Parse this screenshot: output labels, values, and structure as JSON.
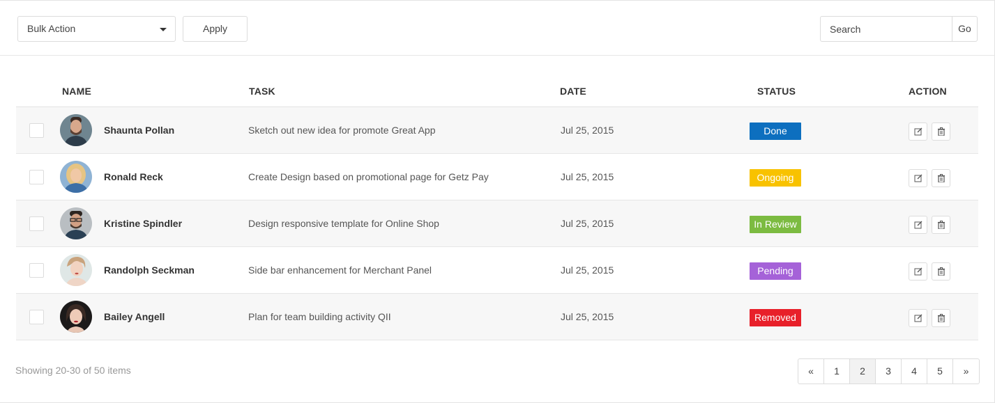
{
  "toolbar": {
    "bulk_action_label": "Bulk Action",
    "apply_label": "Apply",
    "search_placeholder": "Search",
    "go_label": "Go"
  },
  "table": {
    "columns": [
      "NAME",
      "TASK",
      "DATE",
      "STATUS",
      "ACTION"
    ],
    "rows": [
      {
        "name": "Shaunta Pollan",
        "task": "Sketch out new idea for promote Great App",
        "date": "Jul 25, 2015",
        "status": "Done",
        "status_color": "#0d6fbf",
        "avatar": "avatar-man-beard"
      },
      {
        "name": "Ronald Reck",
        "task": "Create Design based on promotional page for Getz Pay",
        "date": "Jul 25, 2015",
        "status": "Ongoing",
        "status_color": "#f8c200",
        "avatar": "avatar-woman-blonde"
      },
      {
        "name": "Kristine Spindler",
        "task": "Design responsive template for Online Shop",
        "date": "Jul 25, 2015",
        "status": "In Review",
        "status_color": "#7cbb41",
        "avatar": "avatar-man-glasses"
      },
      {
        "name": "Randolph Seckman",
        "task": "Side bar enhancement for Merchant Panel",
        "date": "Jul 25, 2015",
        "status": "Pending",
        "status_color": "#a562d8",
        "avatar": "avatar-woman-light"
      },
      {
        "name": "Bailey Angell",
        "task": "Plan for team building activity QII",
        "date": "Jul 25, 2015",
        "status": "Removed",
        "status_color": "#e8202a",
        "avatar": "avatar-woman-dark"
      }
    ]
  },
  "footer": {
    "showing_text": "Showing 20-30 of 50 items",
    "pages": [
      "«",
      "1",
      "2",
      "3",
      "4",
      "5",
      "»"
    ],
    "active_page": "2"
  }
}
